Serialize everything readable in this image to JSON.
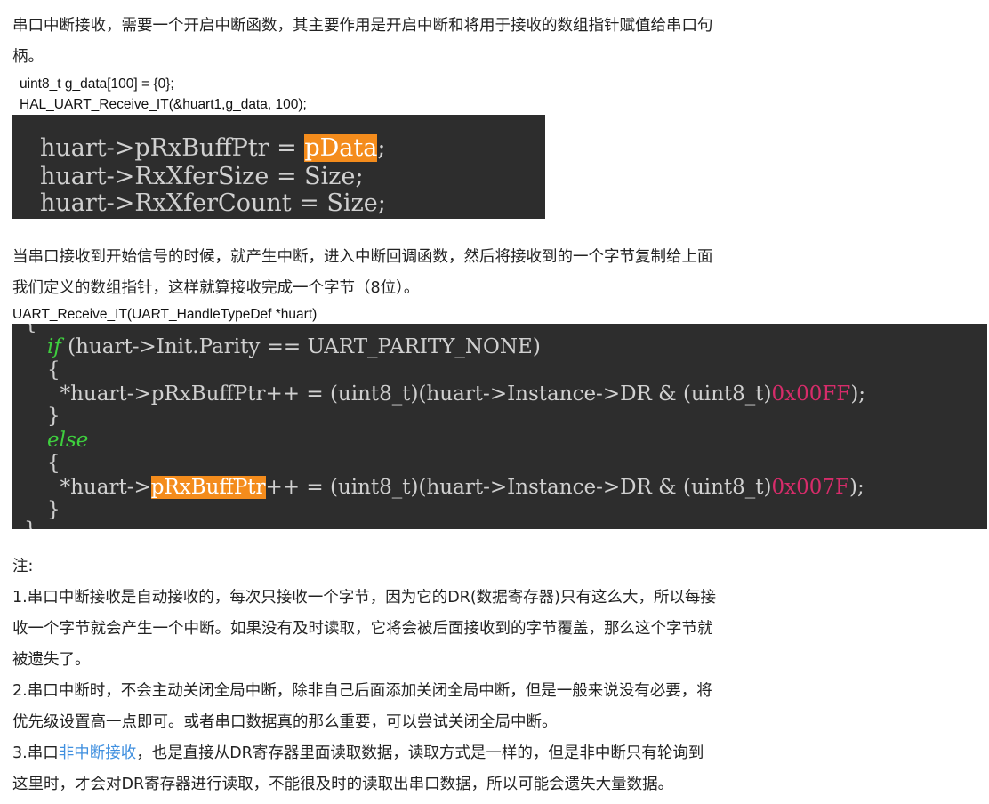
{
  "intro": {
    "line1": "串口中断接收，需要一个开启中断函数，其主要作用是开启中断和将用于接收的数组指针赋值给串口句",
    "line2": "柄。"
  },
  "snippet1": {
    "line1": "uint8_t g_data[100] = {0};",
    "line2": "HAL_UART_Receive_IT(&huart1,g_data, 100);"
  },
  "code1": {
    "l1_prefix": "huart->pRxBuffPtr = ",
    "l1_highlight": "pData",
    "l1_suffix": ";",
    "l2": "huart->RxXferSize = Size;",
    "l3": "huart->RxXferCount = Size;"
  },
  "para2": {
    "line1": "当串口接收到开始信号的时候，就产生中断，进入中断回调函数，然后将接收到的一个字节复制给上面",
    "line2": "我们定义的数组指针，这样就算接收完成一个字节（8位）。"
  },
  "func_sig": "UART_Receive_IT(UART_HandleTypeDef *huart)",
  "code2": {
    "top_brace": "{",
    "if_kw": "if",
    "if_cond": " (huart->Init.Parity == UART_PARITY_NONE)",
    "open1": "{",
    "stmt1_prefix": "  *huart->pRxBuffPtr++ = (uint8_t)(huart->Instance->DR & (uint8_t)",
    "stmt1_num": "0x00FF",
    "stmt1_suffix": ");",
    "close1": "}",
    "else_kw": "else",
    "open2": "{",
    "stmt2_a": "  *huart->",
    "stmt2_hl": "pRxBuffPtr",
    "stmt2_b": "++ = (uint8_t)(huart->Instance->DR & (uint8_t)",
    "stmt2_num": "0x007F",
    "stmt2_suffix": ");",
    "close2": "}",
    "bottom_brace": "}"
  },
  "notes": {
    "title": "注:",
    "n1_l1": "1.串口中断接收是自动接收的，每次只接收一个字节，因为它的DR(数据寄存器)只有这么大，所以每接",
    "n1_l2": "收一个字节就会产生一个中断。如果没有及时读取，它将会被后面接收到的字节覆盖，那么这个字节就",
    "n1_l3": "被遗失了。",
    "n2_l1": "2.串口中断时，不会主动关闭全局中断，除非自己后面添加关闭全局中断，但是一般来说没有必要，将",
    "n2_l2": "优先级设置高一点即可。或者串口数据真的那么重要，可以尝试关闭全局中断。",
    "n3_l1_prefix": "3.串口",
    "n3_l1_link": "非中断接收",
    "n3_l1_suffix": "，也是直接从DR寄存器里面读取数据，读取方式是一样的，但是非中断只有轮询到",
    "n3_l2": "这里时，才会对DR寄存器进行读取，不能很及时的读取出串口数据，所以可能会遗失大量数据。"
  },
  "colors": {
    "code_bg": "#2d2d2d",
    "highlight": "#f48c1c",
    "keyword": "#3ecf3e",
    "number": "#d62c6a",
    "link": "#3f8fdf"
  }
}
